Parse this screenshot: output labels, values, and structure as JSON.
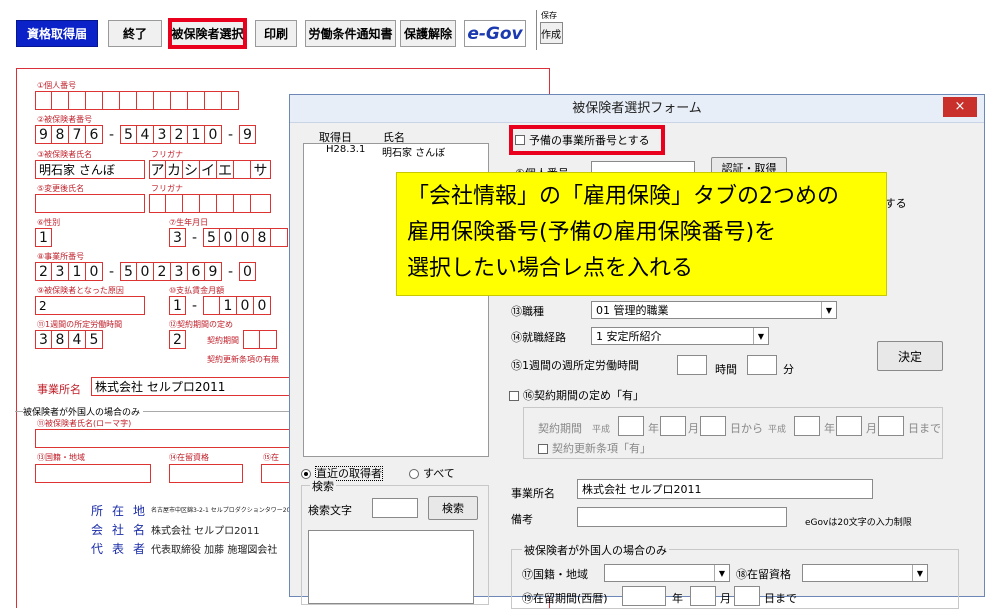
{
  "toolbar": {
    "buttons": [
      "資格取得届",
      "終了",
      "被保険者選択",
      "印刷",
      "労働条件通知書",
      "保護解除"
    ],
    "egov": "e-Gov",
    "egov_small": "(イーガブ)",
    "save_label": "保存",
    "create_label": "作成"
  },
  "form": {
    "l_mynum": "①個人番号",
    "l_insno": "②被保険者番号",
    "insno": [
      "9",
      "8",
      "7",
      "6",
      "-",
      "5",
      "4",
      "3",
      "2",
      "1",
      "0",
      "-",
      "9"
    ],
    "l_name": "③被保険者氏名",
    "furigana_lbl": "フリガナ",
    "name": "明石家 さんぼ",
    "kana": [
      "ア",
      "カ",
      "シ",
      "イ",
      "エ",
      "",
      "サ"
    ],
    "l_change": "⑤変更後氏名",
    "furigana_lbl2": "フリガナ",
    "l_sex": "⑥性別",
    "l_birth": "⑦生年月日",
    "sex": "1",
    "birth": [
      "3",
      "-",
      "5",
      "0",
      "0",
      "8",
      ""
    ],
    "l_office": "⑧事業所番号",
    "office": [
      "2",
      "3",
      "1",
      "0",
      "-",
      "5",
      "0",
      "2",
      "3",
      "6",
      "9",
      "-",
      "0"
    ],
    "l_cause": "⑨被保険者となった原因",
    "l_wage": "⑩支払賃金月額",
    "cause": "2",
    "wage": [
      "1",
      "-",
      "",
      "1",
      "0",
      "0"
    ],
    "l_hours": "⑪1週間の所定労働時間",
    "l_contract": "⑫契約期間の定め",
    "hours": [
      "3",
      "8",
      "4",
      "5"
    ],
    "contract": "2",
    "contract_period": "契約期間",
    "renew": "契約更新条項の有無",
    "office_name_lbl": "事業所名",
    "office_name": "株式会社 セルプロ2011",
    "foreign_hdr": "被保険者が外国人の場合のみ",
    "l_roman": "⑪被保険者氏名(ローマ字)",
    "l_nation": "⑬国籍・地域",
    "l_status": "⑭在留資格",
    "l_status2": "⑮在",
    "addr_lbl": "所在地",
    "addr": "名古屋市中区錦3-2-1 セルプロダクションタワー20F",
    "co_lbl": "会社名",
    "co": "株式会社 セルプロ2011",
    "rep_lbl": "代表者",
    "rep": "代表取締役 加藤 施瑠図会社"
  },
  "dialog": {
    "title": "被保険者選択フォーム",
    "close": "×",
    "col_date": "取得日",
    "col_name": "氏名",
    "rows": [
      {
        "date": "H28.3.1",
        "name": "明石家 さんぼ"
      }
    ],
    "yobi_chk": "予備の事業所番号とする",
    "mynum_lbl": "①個人番号",
    "auth_btn": "認証・取得",
    "partial_text": "hとする",
    "job_lbl": "⑬職種",
    "job_val": "01 管理的職業",
    "route_lbl": "⑭就職経路",
    "route_val": "1 安定所紹介",
    "weekly_lbl": "⑮1週間の週所定労働時間",
    "hours_unit": "時間",
    "min_unit": "分",
    "decide_btn": "決定",
    "contract_chk": "⑯契約期間の定め「有」",
    "period_lbl": "契約期間",
    "heisei": "平成",
    "year": "年",
    "month": "月",
    "day_from": "日から",
    "heisei2": "平成",
    "year2": "年",
    "month2": "月",
    "day_to": "日まで",
    "renew_chk": "契約更新条項「有」",
    "radio_recent": "直近の取得者",
    "radio_all": "すべて",
    "search_group": "検索",
    "search_lbl": "検索文字",
    "search_btn": "検索",
    "office_lbl": "事業所名",
    "office_val": "株式会社 セルプロ2011",
    "note_lbl": "備考",
    "egov_note": "eGovは20文字の入力制限",
    "foreign_group": "被保険者が外国人の場合のみ",
    "nation_lbl": "⑰国籍・地域",
    "status_lbl": "⑱在留資格",
    "period2_lbl": "⑲在留期間(西暦)",
    "y2": "年",
    "m2": "月",
    "d2": "日まで"
  },
  "callout": {
    "line1": "「会社情報」の「雇用保険」タブの2つめの",
    "line2": "雇用保険番号(予備の雇用保険番号)を",
    "line3": "選択したい場合レ点を入れる"
  },
  "colors": {
    "highlight": "#e8001c",
    "callout": "#ffff00",
    "toolbar_blue": "#0b22c9",
    "form_red": "#d33"
  }
}
